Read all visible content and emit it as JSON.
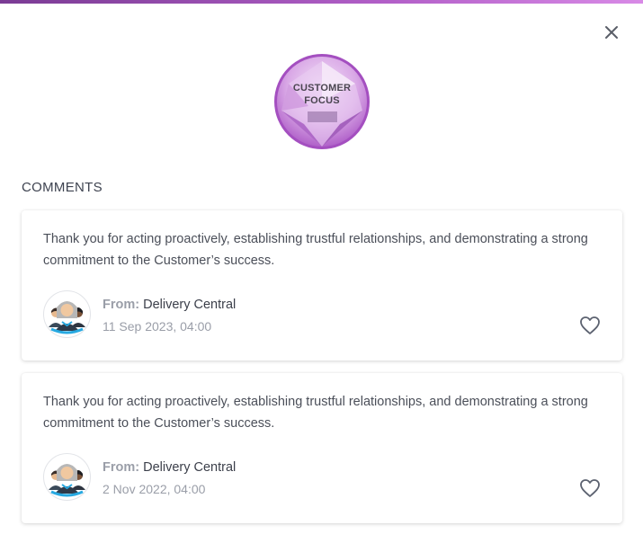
{
  "badge": {
    "line1": "CUSTOMER",
    "line2": "FOCUS"
  },
  "comments_title": "COMMENTS",
  "comments": [
    {
      "text": "Thank you for acting proactively, establishing trustful relationships, and demonstrating a strong commitment to the Customer’s success.",
      "from_label": "From:",
      "from_name": "Delivery Central",
      "date": "11 Sep 2023, 04:00"
    },
    {
      "text": "Thank you for acting proactively, establishing trustful relationships, and demonstrating a strong commitment to the Customer’s success.",
      "from_label": "From:",
      "from_name": "Delivery Central",
      "date": "2 Nov 2022, 04:00"
    }
  ],
  "colors": {
    "accent_bar": "#a552c0",
    "badge_purple": "#b562cc",
    "text_muted": "#9a9ea8"
  },
  "icons": {
    "close": "close-icon",
    "like": "heart-outline-icon",
    "avatar": "group-avatar-icon"
  }
}
